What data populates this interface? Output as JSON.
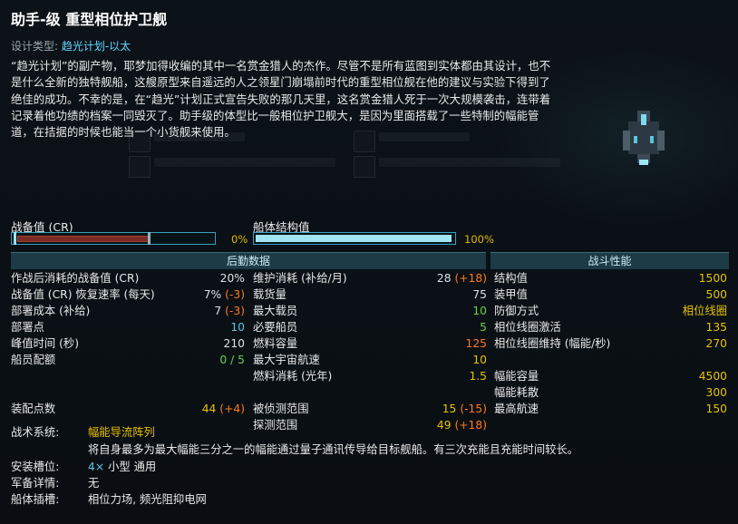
{
  "header": {
    "title": "助手-级 重型相位护卫舰",
    "design_type_label": "设计类型: ",
    "design_type_value": "趋光计划-以太"
  },
  "description": "“趋光计划”的副产物，耶梦加得收编的其中一名赏金猎人的杰作。尽管不是所有蓝图到实体都由其设计，也不是什么全新的独特舰船，这艘原型来自遥远的人之领星门崩塌前时代的重型相位舰在他的建议与实验下得到了绝佳的成功。不幸的是，在“趋光”计划正式宣告失败的那几天里，这名赏金猎人死于一次大规模袭击，连带着记录着他功绩的档案一同毁灭了。助手级的体型比一般相位护卫舰大，是因为里面搭载了一些特制的幅能管道，在拮据的时候也能当一个小货舰来使用。",
  "cr": {
    "label": "战备值 (CR)",
    "value": "0%",
    "fraction": 0
  },
  "hull": {
    "label": "船体结构值",
    "value": "100%",
    "fraction": 1
  },
  "sections": {
    "logistics": "后勤数据",
    "combat": "战斗性能"
  },
  "logistics": [
    {
      "label": "作战后消耗的战备值 (CR)",
      "value": "20%",
      "mod": "",
      "color": "w"
    },
    {
      "label": "战备值 (CR) 恢复速率 (每天)",
      "value": "7%",
      "mod": "(-3)",
      "color": "w"
    },
    {
      "label": "部署成本 (补给)",
      "value": "7",
      "mod": "(-3)",
      "color": "w"
    },
    {
      "label": "部署点",
      "value": "10",
      "mod": "",
      "color": "c"
    },
    {
      "label": "峰值时间 (秒)",
      "value": "210",
      "mod": "",
      "color": "w"
    },
    {
      "label": "船员配额",
      "value": "0 / 5",
      "mod": "",
      "color": "g"
    }
  ],
  "ordnance": {
    "label": "装配点数",
    "value": "44",
    "mod": "(+4)"
  },
  "logistics2": [
    {
      "label": "维护消耗 (补给/月)",
      "value": "28",
      "mod": "(+18)",
      "color": "w"
    },
    {
      "label": "载货量",
      "value": "75",
      "mod": "",
      "color": "w"
    },
    {
      "label": "最大载员",
      "value": "10",
      "mod": "",
      "color": "g"
    },
    {
      "label": "必要船员",
      "value": "5",
      "mod": "",
      "color": "g"
    },
    {
      "label": "燃料容量",
      "value": "125",
      "mod": "",
      "color": "o"
    },
    {
      "label": "最大宇宙航速",
      "value": "10",
      "mod": "",
      "color": "y"
    },
    {
      "label": "燃料消耗 (光年)",
      "value": "1.5",
      "mod": "",
      "color": "y"
    }
  ],
  "sensors": [
    {
      "label": "被侦测范围",
      "value": "15",
      "mod": "(-15)",
      "color": "y"
    },
    {
      "label": "探测范围",
      "value": "49",
      "mod": "(+18)",
      "color": "y"
    }
  ],
  "combat": [
    {
      "label": "结构值",
      "value": "1500",
      "color": "y"
    },
    {
      "label": "装甲值",
      "value": "500",
      "color": "y"
    },
    {
      "label": "防御方式",
      "value": "相位线圈",
      "color": "y"
    },
    {
      "label": "相位线圈激活",
      "value": "135",
      "color": "y"
    },
    {
      "label": "相位线圈维持 (幅能/秒)",
      "value": "270",
      "color": "y"
    }
  ],
  "combat2": [
    {
      "label": "幅能容量",
      "value": "4500",
      "color": "y"
    },
    {
      "label": "幅能耗散",
      "value": "300",
      "color": "y"
    },
    {
      "label": "最高航速",
      "value": "150",
      "color": "y"
    }
  ],
  "system": {
    "label": "战术系统:",
    "name": "幅能导流阵列",
    "desc": "将自身最多为最大幅能三分之一的幅能通过量子通讯传导给目标舰船。有三次充能且充能时间较长。"
  },
  "mounts": {
    "label": "安装槽位:",
    "count": "4×",
    "value": "小型 通用"
  },
  "builtin_wings": {
    "label": "军备详情:",
    "value": "无"
  },
  "hullmods": {
    "label": "船体插槽:",
    "value": "相位力场, 频光阻抑电网"
  },
  "colors": {
    "yellow": "#e8c200",
    "green": "#66d24a",
    "cyan": "#58c8e0",
    "orange": "#ff7a1a",
    "header": "#1d3a47"
  }
}
